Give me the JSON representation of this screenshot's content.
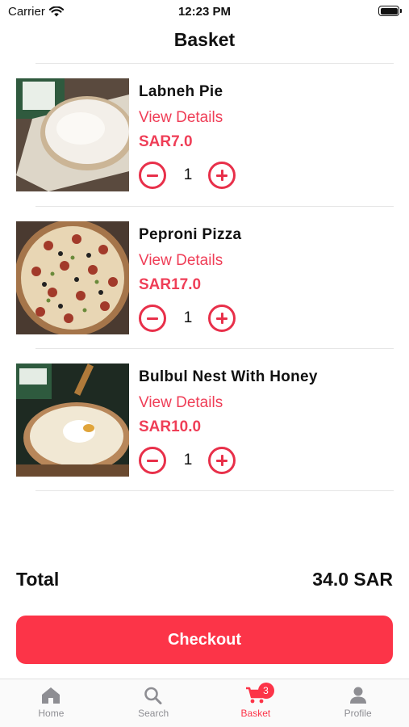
{
  "status_bar": {
    "carrier": "Carrier",
    "time": "12:23 PM"
  },
  "header": {
    "title": "Basket"
  },
  "items": [
    {
      "name": "Labneh Pie",
      "details_label": "View Details",
      "price": "SAR7.0",
      "quantity": "1"
    },
    {
      "name": "Peproni Pizza",
      "details_label": "View Details",
      "price": "SAR17.0",
      "quantity": "1"
    },
    {
      "name": "Bulbul Nest With Honey",
      "details_label": "View Details",
      "price": "SAR10.0",
      "quantity": "1"
    }
  ],
  "summary": {
    "total_label": "Total",
    "total_value": "34.0 SAR"
  },
  "checkout": {
    "label": "Checkout"
  },
  "tabbar": {
    "tabs": [
      {
        "label": "Home",
        "icon": "home-icon"
      },
      {
        "label": "Search",
        "icon": "search-icon"
      },
      {
        "label": "Basket",
        "icon": "cart-icon",
        "badge": "3",
        "active": true
      },
      {
        "label": "Profile",
        "icon": "person-icon"
      }
    ]
  },
  "colors": {
    "accent": "#fc3448",
    "text_accent": "#ef3e57",
    "divider": "#e6e6e6"
  }
}
